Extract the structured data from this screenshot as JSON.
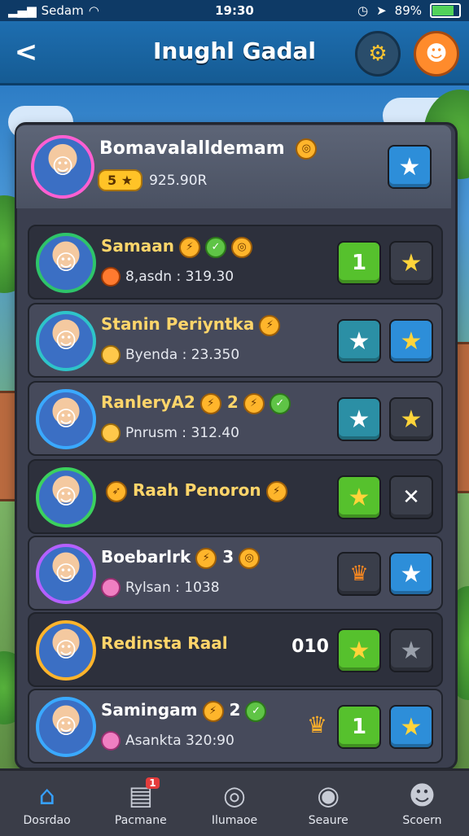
{
  "status_bar": {
    "carrier": "Sedam",
    "time": "19:30",
    "battery": "89%"
  },
  "header": {
    "title": "Inughl Gadal",
    "back_icon": "chevron-left-icon",
    "settings_icon": "gear-icon",
    "profile_icon": "profile-icon"
  },
  "me": {
    "name": "Bomavalalldemam",
    "level": "5",
    "score": "925.90R"
  },
  "rows": [
    {
      "name": "Samaan",
      "sub": "8,asdn : 319.30",
      "btn1": "1",
      "btn2": "★"
    },
    {
      "name": "Stanin Periyntka",
      "sub": "Byenda : 23.350",
      "btn1": "★",
      "btn2": "★"
    },
    {
      "name": "RanleryA2",
      "extra": "2",
      "sub": "Pnrusm : 312.40",
      "btn1": "★",
      "btn2": "★"
    },
    {
      "name": "Raah Penoron",
      "sub": "",
      "btn1": "★",
      "btn2": "✕"
    },
    {
      "name": "Boebarlrk",
      "extra": "3",
      "sub": "Rylsan : 1038",
      "btn1": "♛",
      "btn2": "★"
    },
    {
      "name": "Redinsta Raal",
      "sub": "",
      "count": "010",
      "btn1": "★",
      "btn2": "★"
    },
    {
      "name": "Samingam",
      "extra": "2",
      "sub": "Asankta 320:90",
      "btn1": "1",
      "btn2": "★"
    }
  ],
  "nav": [
    {
      "label": "Dosrdao",
      "icon": "home-icon"
    },
    {
      "label": "Pacmane",
      "icon": "news-icon",
      "badge": "1"
    },
    {
      "label": "Ilumaoe",
      "icon": "target-icon"
    },
    {
      "label": "Seaure",
      "icon": "globe-icon"
    },
    {
      "label": "Scoern",
      "icon": "friends-icon"
    }
  ]
}
